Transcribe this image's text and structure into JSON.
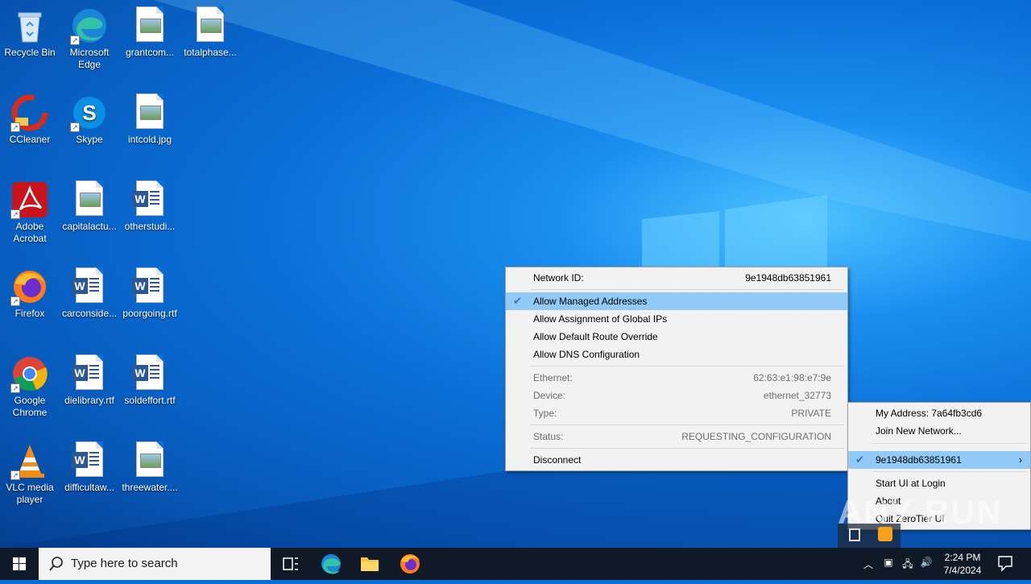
{
  "desktop": {
    "icons": [
      {
        "label": "Recycle Bin"
      },
      {
        "label": "Microsoft Edge"
      },
      {
        "label": "grantcom..."
      },
      {
        "label": "totalphase..."
      },
      {
        "label": "CCleaner"
      },
      {
        "label": "Skype"
      },
      {
        "label": "intcold.jpg"
      },
      {
        "label": "Adobe Acrobat"
      },
      {
        "label": "capitalactu..."
      },
      {
        "label": "otherstudi..."
      },
      {
        "label": "Firefox"
      },
      {
        "label": "carconside..."
      },
      {
        "label": "poorgoing.rtf"
      },
      {
        "label": "Google Chrome"
      },
      {
        "label": "dielibrary.rtf"
      },
      {
        "label": "soldeffort.rtf"
      },
      {
        "label": "VLC media player"
      },
      {
        "label": "difficultaw..."
      },
      {
        "label": "threewater...."
      }
    ]
  },
  "network_menu": {
    "network_id_label": "Network ID:",
    "network_id_value": "9e1948db63851961",
    "options": [
      {
        "label": "Allow Managed Addresses",
        "checked": true
      },
      {
        "label": "Allow Assignment of Global IPs",
        "checked": false
      },
      {
        "label": "Allow Default Route Override",
        "checked": false
      },
      {
        "label": "Allow DNS Configuration",
        "checked": false
      }
    ],
    "info": [
      {
        "label": "Ethernet:",
        "value": "62:63:e1:98:e7:9e"
      },
      {
        "label": "Device:",
        "value": "ethernet_32773"
      },
      {
        "label": "Type:",
        "value": "PRIVATE"
      }
    ],
    "status_label": "Status:",
    "status_value": "REQUESTING_CONFIGURATION",
    "disconnect_label": "Disconnect"
  },
  "zerotier_menu": {
    "my_address": "My Address:  7a64fb3cd6",
    "join_network": "Join New Network...",
    "network_item": "9e1948db63851961",
    "start_ui_login": "Start UI at Login",
    "about": "About",
    "quit": "Quit ZeroTier UI"
  },
  "taskbar": {
    "search_placeholder": "Type here to search",
    "time": "2:24 PM",
    "date": "7/4/2024"
  },
  "watermark": "ANY RUN",
  "colors": {
    "accent": "#0078d7",
    "highlight": "#91c9f7",
    "taskbar": "#101a27"
  }
}
